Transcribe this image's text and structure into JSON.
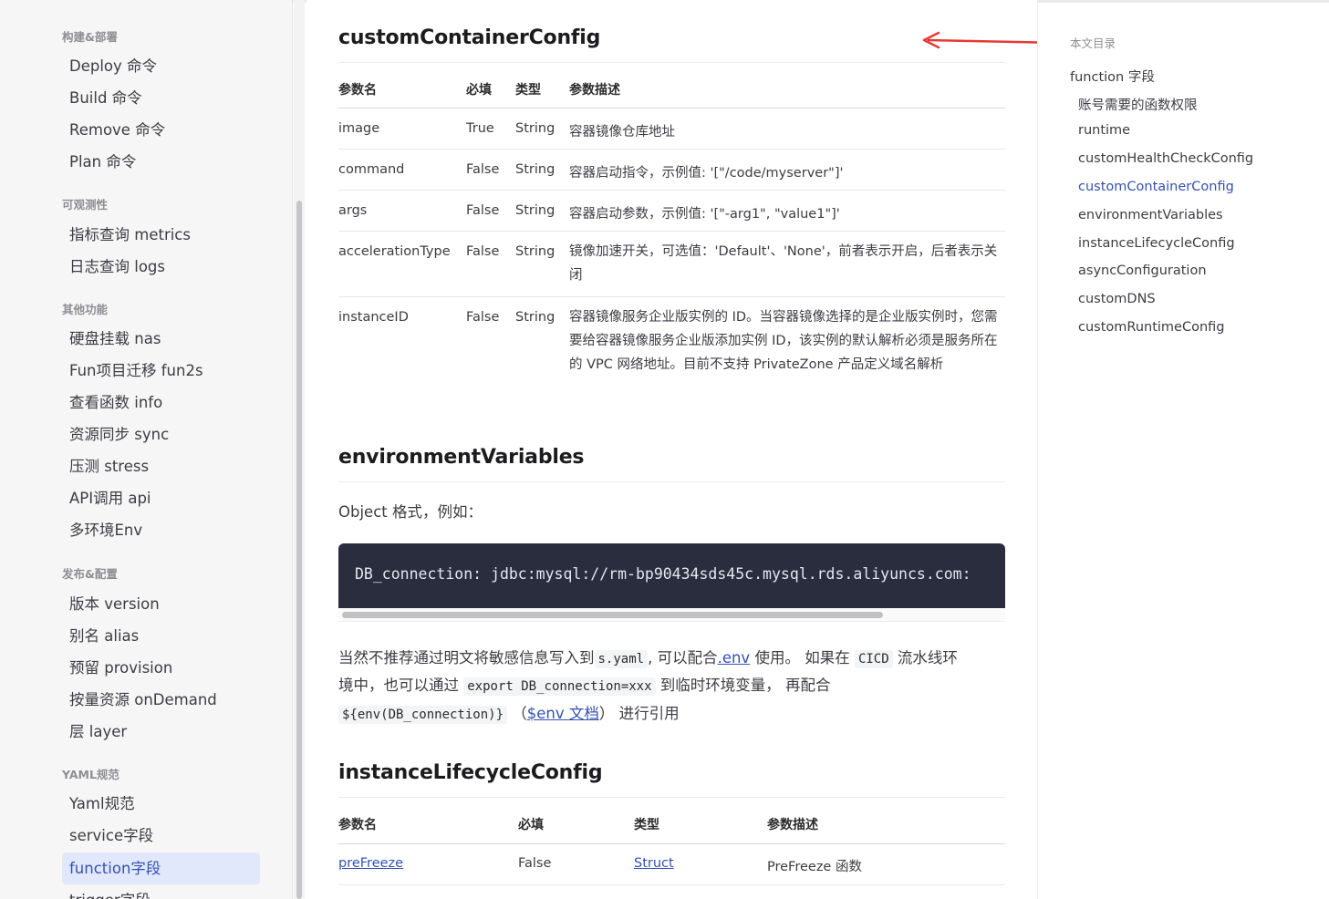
{
  "sidebar": {
    "groups": [
      {
        "title": "构建&部署",
        "items": [
          "Deploy 命令",
          "Build 命令",
          "Remove 命令",
          "Plan 命令"
        ]
      },
      {
        "title": "可观测性",
        "items": [
          "指标查询 metrics",
          "日志查询 logs"
        ]
      },
      {
        "title": "其他功能",
        "items": [
          "硬盘挂载 nas",
          "Fun项目迁移 fun2s",
          "查看函数 info",
          "资源同步 sync",
          "压测 stress",
          "API调用 api",
          "多环境Env"
        ]
      },
      {
        "title": "发布&配置",
        "items": [
          "版本 version",
          "别名 alias",
          "预留 provision",
          "按量资源 onDemand",
          "层 layer"
        ]
      },
      {
        "title": "YAML规范",
        "items": [
          "Yaml规范",
          "service字段",
          "function字段",
          "trigger字段"
        ]
      }
    ]
  },
  "main": {
    "section1": {
      "heading": "customContainerConfig",
      "headers": [
        "参数名",
        "必填",
        "类型",
        "参数描述"
      ],
      "rows": [
        {
          "name": "image",
          "required": "True",
          "type": "String",
          "desc": "容器镜像仓库地址"
        },
        {
          "name": "command",
          "required": "False",
          "type": "String",
          "desc": "容器启动指令，示例值: '[\"/code/myserver\"]'"
        },
        {
          "name": "args",
          "required": "False",
          "type": "String",
          "desc": "容器启动参数，示例值: '[\"-arg1\", \"value1\"]'"
        },
        {
          "name": "accelerationType",
          "required": "False",
          "type": "String",
          "desc": "镜像加速开关，可选值：'Default'、'None'，前者表示开启，后者表示关闭"
        },
        {
          "name": "instanceID",
          "required": "False",
          "type": "String",
          "desc": "容器镜像服务企业版实例的 ID。当容器镜像选择的是企业版实例时，您需要给容器镜像服务企业版添加实例 ID，该实例的默认解析必须是服务所在的 VPC 网络地址。目前不支持 PrivateZone 产品定义域名解析"
        }
      ]
    },
    "section2": {
      "heading": "environmentVariables",
      "intro": "Object 格式，例如：",
      "code": "DB_connection: jdbc:mysql://rm-bp90434sds45c.mysql.rds.aliyuncs.com:",
      "p1_a": "当然不推荐通过明文将敏感信息写入到",
      "p1_code": "s.yaml",
      "p1_b": ", 可以配合",
      "p1_link": ".env",
      "p1_c": " 使用。 如果在 ",
      "p1_code2": "CICD",
      "p1_d": " 流水线环",
      "p2_a": "境中，也可以通过 ",
      "p2_code": "export DB_connection=xxx",
      "p2_b": " 到临时环境变量， 再配合",
      "p3_code": "${env(DB_connection)}",
      "p3_a": " （",
      "p3_link": "$env 文档",
      "p3_b": "） 进行引用"
    },
    "section3": {
      "heading": "instanceLifecycleConfig",
      "headers": [
        "参数名",
        "必填",
        "类型",
        "参数描述"
      ],
      "rows": [
        {
          "name": "preFreeze",
          "required": "False",
          "type": "Struct",
          "desc": "PreFreeze 函数"
        }
      ]
    }
  },
  "toc": {
    "title": "本文目录",
    "items": [
      {
        "label": "function 字段",
        "level": 1
      },
      {
        "label": "账号需要的函数权限",
        "level": 2
      },
      {
        "label": "runtime",
        "level": 2
      },
      {
        "label": "customHealthCheckConfig",
        "level": 2
      },
      {
        "label": "customContainerConfig",
        "level": 2,
        "active": true
      },
      {
        "label": "environmentVariables",
        "level": 2
      },
      {
        "label": "instanceLifecycleConfig",
        "level": 2
      },
      {
        "label": "asyncConfiguration",
        "level": 2
      },
      {
        "label": "customDNS",
        "level": 2
      },
      {
        "label": "customRuntimeConfig",
        "level": 2
      }
    ]
  },
  "colors": {
    "accent": "#3451b2",
    "annotation_arrow": "#e53935",
    "code_bg": "#292d3e"
  }
}
